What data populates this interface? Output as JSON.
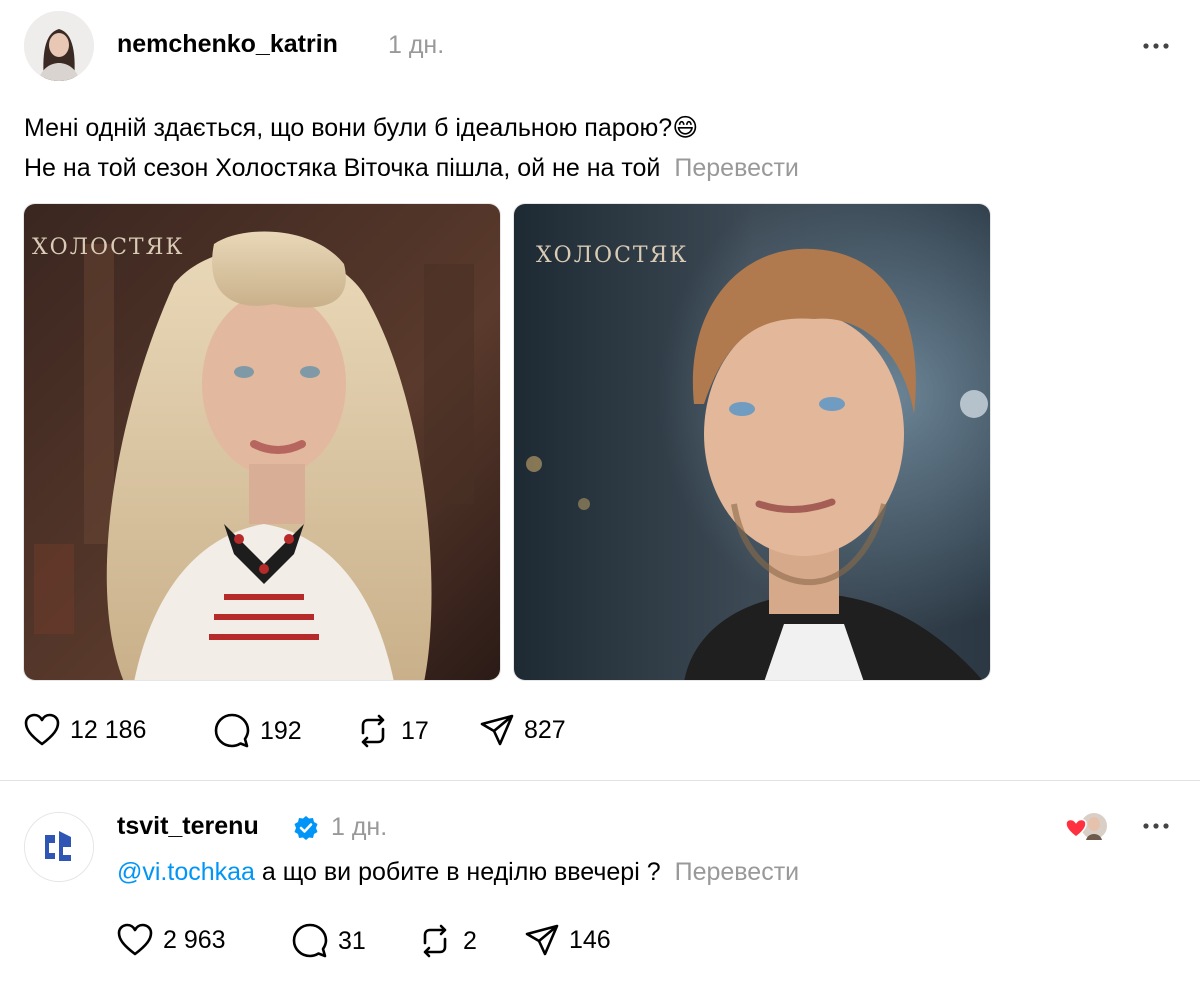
{
  "post": {
    "username": "nemchenko_katrin",
    "time": "1 дн.",
    "line1": "Мені одній здається, що вони були б ідеальною парою?😄",
    "line2": "Не на той сезон Холостяка Віточка пішла, ой не на той",
    "translate": "Перевести",
    "watermark": "ХОЛОСТЯК",
    "actions": {
      "likes": "12 186",
      "comments": "192",
      "reposts": "17",
      "shares": "827"
    }
  },
  "reply": {
    "username": "tsvit_terenu",
    "time": "1 дн.",
    "mention": "@vi.tochkaa",
    "text": "а що ви робите в неділю ввечері ?",
    "translate": "Перевести",
    "actions": {
      "likes": "2 963",
      "comments": "31",
      "reposts": "2",
      "shares": "146"
    }
  },
  "colors": {
    "mention": "#0095f6",
    "muted": "#999999",
    "heart": "#ff3040",
    "verified": "#0095f6"
  },
  "icons": [
    "more-icon",
    "verified-badge-icon",
    "heart-icon",
    "comment-icon",
    "repost-icon",
    "share-icon"
  ]
}
